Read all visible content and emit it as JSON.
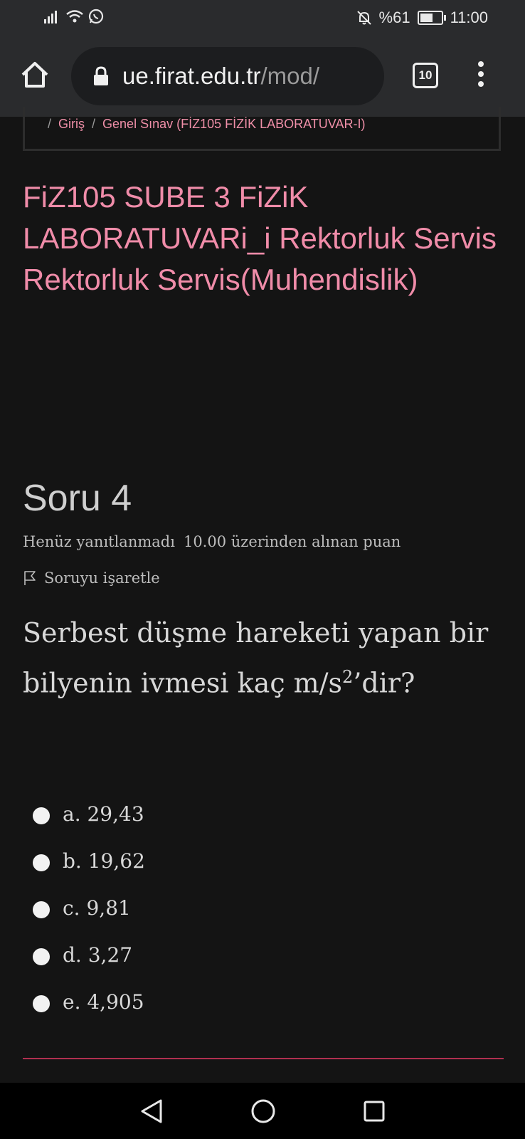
{
  "status_bar": {
    "battery_text": "%61",
    "time": "11:00"
  },
  "browser": {
    "url_host": "ue.firat.edu.tr",
    "url_path": "/mod/",
    "tab_count": "10"
  },
  "breadcrumb": {
    "separator": "/",
    "items": [
      "Giriş",
      "Genel Sınav (FİZ105 FİZİK LABORATUVAR-I)"
    ]
  },
  "course": {
    "title": "FiZ105 SUBE 3 FiZiK LABORATUVARi_i Rektorluk Servis Rektorluk Servis(Muhendislik)"
  },
  "question": {
    "title": "Soru 4",
    "state": "Henüz yanıtlanmadı",
    "grade": "10.00 üzerinden alınan puan",
    "flag_label": "Soruyu işaretle",
    "text_before": "Serbest düşme hareketi yapan bir bilyenin ivmesi kaç m/s",
    "superscript": "2",
    "text_after": "’dir?",
    "options": [
      {
        "label": "a. 29,43"
      },
      {
        "label": "b. 19,62"
      },
      {
        "label": "c. 9,81"
      },
      {
        "label": "d. 3,27"
      },
      {
        "label": "e. 4,905"
      }
    ]
  },
  "colors": {
    "accent": "#f08ca9",
    "background": "#141414",
    "divider": "#b03050"
  }
}
